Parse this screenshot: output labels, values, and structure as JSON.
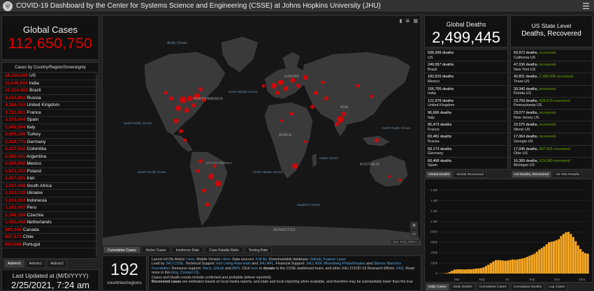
{
  "header": {
    "title": "COVID-19 Dashboard by the Center for Systems Science and Engineering (CSSE) at Johns Hopkins University (JHU)"
  },
  "global_cases": {
    "title": "Global Cases",
    "value": "112,650,750"
  },
  "country_list": {
    "header": "Cases by Country/Region/Sovereignty",
    "rows": [
      {
        "n": "28,336,566",
        "c": "US"
      },
      {
        "n": "11,046,914",
        "c": "India"
      },
      {
        "n": "10,324,463",
        "c": "Brazil"
      },
      {
        "n": "4,164,802",
        "c": "Russia"
      },
      {
        "n": "4,156,703",
        "c": "United Kingdom"
      },
      {
        "n": "3,721,061",
        "c": "France"
      },
      {
        "n": "3,170,644",
        "c": "Spain"
      },
      {
        "n": "2,848,564",
        "c": "Italy"
      },
      {
        "n": "2,665,196",
        "c": "Turkey"
      },
      {
        "n": "2,419,771",
        "c": "Germany"
      },
      {
        "n": "2,237,542",
        "c": "Colombia"
      },
      {
        "n": "2,085,411",
        "c": "Argentina"
      },
      {
        "n": "2,060,908",
        "c": "Mexico"
      },
      {
        "n": "1,673,252",
        "c": "Poland"
      },
      {
        "n": "1,607,081",
        "c": "Iran"
      },
      {
        "n": "1,507,448",
        "c": "South Africa"
      },
      {
        "n": "1,373,139",
        "c": "Ukraine"
      },
      {
        "n": "1,314,634",
        "c": "Indonesia"
      },
      {
        "n": "1,293,497",
        "c": "Peru"
      },
      {
        "n": "1,198,169",
        "c": "Czechia"
      },
      {
        "n": "1,083,448",
        "c": "Netherlands"
      },
      {
        "n": "860,348",
        "c": "Canada"
      },
      {
        "n": "807,672",
        "c": "Chile"
      },
      {
        "n": "800,586",
        "c": "Portugal"
      }
    ]
  },
  "admin_tabs": [
    "Admin0",
    "Admin1",
    "Admin2"
  ],
  "last_updated": {
    "title": "Last Updated at (M/D/YYYY)",
    "value": "2/25/2021, 7:24 am"
  },
  "map": {
    "labels": {
      "arctic": "Arctic Ocean",
      "north_america": "NORTH AMERICA",
      "north_atlantic": "North Atlantic Ocean",
      "europe": "EUROPE",
      "asia": "ASIA",
      "north_pacific_l": "North Pacific Ocean",
      "north_pacific_r": "North Pacific Ocean",
      "africa": "AFRICA",
      "south_america": "SOUTH AMERICA",
      "south_pacific": "South Pacific Ocean",
      "south_atlantic": "South Atlantic Ocean",
      "indian": "Indian Ocean",
      "australia": "AUSTRALIA",
      "southern": "Southern Ocean",
      "antarctica": "ANTARCTICA"
    },
    "attribution": "Esri, FAO, NOAA",
    "zoom_in": "+",
    "zoom_out": "−"
  },
  "map_tabs": [
    "Cumulative Cases",
    "Active Cases",
    "Incidence Rate",
    "Case-Fatality Ratio",
    "Testing Rate"
  ],
  "regions": {
    "value": "192",
    "label": "countries/regions"
  },
  "info": {
    "line1_a": "Lancet Inf Dis Article: ",
    "line1_b": "Here",
    "line1_c": ". Mobile Version: ",
    "line1_d": "Here",
    "line1_e": ". Data sources: ",
    "line1_f": "Full list",
    "line1_g": ". Downloadable database: ",
    "line1_h": "GitHub",
    "line1_i": ", ",
    "line1_j": "Feature Layer",
    "line1_k": ".",
    "line2_a": "Lead by ",
    "line2_b": "JHU CSSE",
    "line2_c": ". Technical Support: ",
    "line2_d": "Esri Living Atlas team",
    "line2_e": " and ",
    "line2_f": "JHU APL",
    "line2_g": ". Financial Support: ",
    "line2_h": "JHU",
    "line2_i": ", ",
    "line2_j": "NSF",
    "line2_k": ", ",
    "line2_l": "Bloomberg Philanthropies",
    "line2_m": " and ",
    "line2_n": "Stavros Niarchos Foundation",
    "line2_o": ". Resource support: ",
    "line2_p": "Slack",
    "line2_q": ", ",
    "line2_r": "Github",
    "line2_s": " and ",
    "line2_t": "AWS",
    "line2_u": ". Click ",
    "line2_v": "here",
    "line2_w": " to ",
    "line2_x": "donate",
    "line2_y": " to the CSSE dashboard team, and other JHU COVID-19 Research Efforts. ",
    "line2_z": "FAQ",
    "line2_aa": ". Read more in this ",
    "line2_ab": "blog",
    "line2_ac": ". ",
    "line2_ad": "Contact US",
    "line2_ae": ".",
    "line3": "Cases and Death counts include confirmed and probable (where reported).",
    "line4_a": "Recovered cases",
    "line4_b": " are estimates based on local media reports, and state and local reporting when available, and therefore may be substantially lower than the true"
  },
  "global_deaths": {
    "title": "Global Deaths",
    "value": "2,499,445",
    "rows": [
      {
        "a": "505,099 deaths",
        "b": "US"
      },
      {
        "a": "249,957 deaths",
        "b": "Brazil"
      },
      {
        "a": "182,815 deaths",
        "b": "Mexico"
      },
      {
        "a": "156,705 deaths",
        "b": "India"
      },
      {
        "a": "121,979 deaths",
        "b": "United Kingdom"
      },
      {
        "a": "96,666 deaths",
        "b": "Italy"
      },
      {
        "a": "85,473 deaths",
        "b": "France"
      },
      {
        "a": "83,481 deaths",
        "b": "Russia"
      },
      {
        "a": "69,173 deaths",
        "b": "Germany"
      },
      {
        "a": "68,468 deaths",
        "b": "Spain"
      },
      {
        "a": "59,839 deaths",
        "b": ""
      }
    ]
  },
  "deaths_tabs": [
    "Global Deaths",
    "Global Recovered"
  ],
  "us_state": {
    "title1": "US State Level",
    "title2": "Deaths, Recovered",
    "rows": [
      {
        "d": "50,972 deaths, ",
        "r": "recovered",
        "b": "California US"
      },
      {
        "d": "47,156 deaths, ",
        "r": "recovered",
        "b": "New York US"
      },
      {
        "d": "42,831 deaths, ",
        "r": "2,368,008 recovered",
        "b": "Texas US"
      },
      {
        "d": "30,340 deaths, ",
        "r": "recovered",
        "b": "Florida US"
      },
      {
        "d": "23,759 deaths, ",
        "r": "828,570 recovered",
        "b": "Pennsylvania US"
      },
      {
        "d": "23,077 deaths, ",
        "r": "recovered",
        "b": "New Jersey US"
      },
      {
        "d": "22,575 deaths, ",
        "r": "recovered",
        "b": "Illinois US"
      },
      {
        "d": "17,064 deaths, ",
        "r": "recovered",
        "b": "Georgia US"
      },
      {
        "d": "17,045 deaths, ",
        "r": "897,425 recovered",
        "b": "Ohio US"
      },
      {
        "d": "16,389 deaths, ",
        "r": "529,080 recovered",
        "b": "Michigan US"
      },
      {
        "d": "15,985 deaths, ",
        "r": "477,786 recovered",
        "b": ""
      }
    ]
  },
  "us_tabs": [
    "US Deaths, Recovered",
    "US Test Results"
  ],
  "chart_data": {
    "type": "bar",
    "title": "",
    "xlabel": "",
    "ylabel": "",
    "x_ticks": [
      "Mar",
      "May",
      "Jul",
      "Sep",
      "Nov",
      "2021"
    ],
    "y_ticks": [
      "0",
      "200k",
      "400k",
      "600k",
      "800k",
      "1.0M",
      "1.2M",
      "1.4M",
      "1.6M"
    ],
    "ylim": [
      0,
      1700000
    ],
    "color": "#f5a623",
    "values": [
      2000,
      3000,
      5000,
      12000,
      30000,
      55000,
      75000,
      80000,
      82000,
      80000,
      78000,
      80000,
      85000,
      82000,
      90000,
      95000,
      100000,
      105000,
      120000,
      145000,
      170000,
      200000,
      230000,
      255000,
      260000,
      255000,
      250000,
      245000,
      250000,
      260000,
      270000,
      265000,
      270000,
      280000,
      290000,
      300000,
      320000,
      340000,
      360000,
      380000,
      420000,
      460000,
      490000,
      520000,
      560000,
      600000,
      610000,
      620000,
      640000,
      660000,
      720000,
      760000,
      790000,
      800000,
      760000,
      700000,
      620000,
      540000,
      470000,
      420000,
      390000,
      380000
    ]
  },
  "chart_tabs": [
    "Daily Cases",
    "Daily Deaths",
    "Cumulative Cases",
    "Cumulative Deaths",
    "Log Cases"
  ]
}
